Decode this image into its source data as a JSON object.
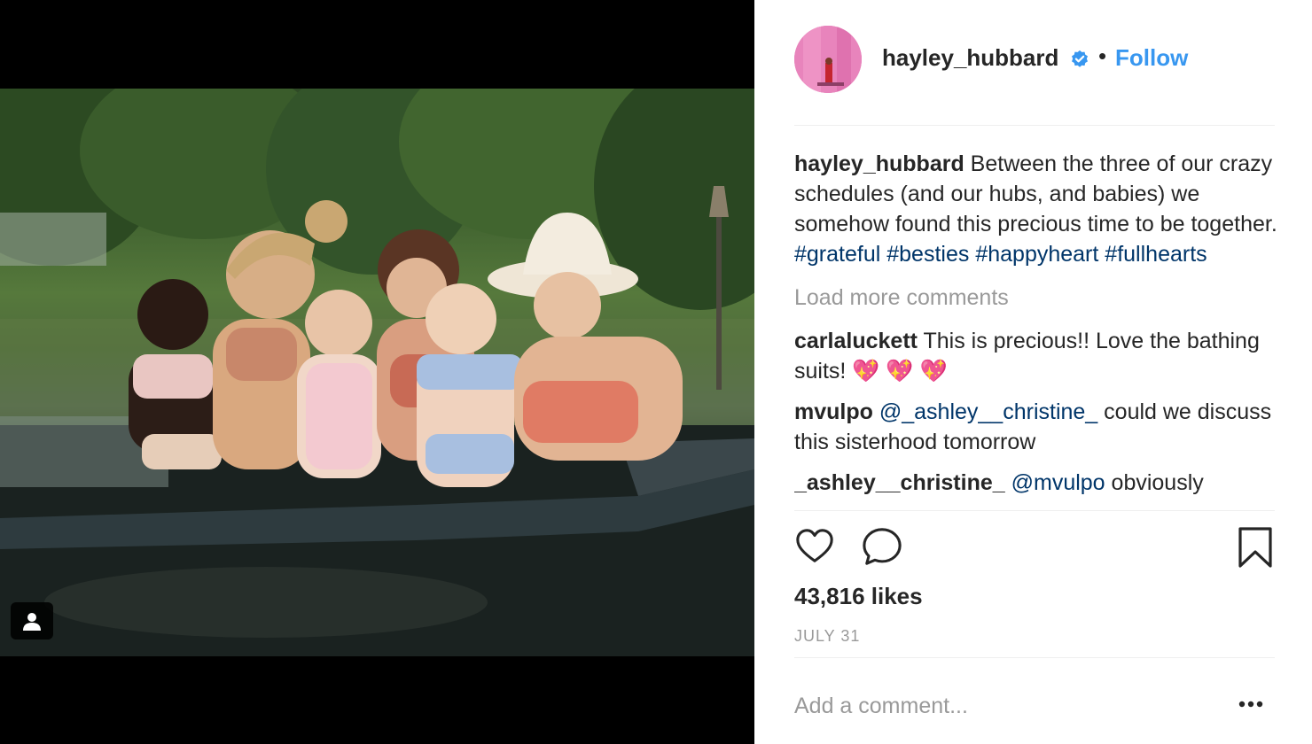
{
  "post": {
    "username": "hayley_hubbard",
    "separator": "•",
    "follow_label": "Follow",
    "verified_icon": "verified-badge-icon",
    "caption_username": "hayley_hubbard",
    "caption_text": " Between the three of our crazy schedules (and our hubs, and babies) we somehow found this precious time to be together. ",
    "hashtags": [
      "#grateful",
      "#besties",
      "#happyheart",
      "#fullhearts"
    ],
    "load_more_label": "Load more comments",
    "comments": [
      {
        "username": "carlaluckett",
        "text": " This is precious!! Love the bathing suits! 💖 💖 💖"
      },
      {
        "username": "mvulpo",
        "mention": "@_ashley__christine_",
        "text": " could we discuss this sisterhood tomorrow"
      },
      {
        "username": "_ashley__christine_",
        "mention": "@mvulpo",
        "text": " obviously"
      }
    ],
    "likes_label": "43,816 likes",
    "date_label": "JULY 31",
    "add_comment_placeholder": "Add a comment...",
    "more_label": "•••"
  },
  "colors": {
    "link_blue": "#3897f0",
    "hashtag_navy": "#003569",
    "muted_gray": "#999999",
    "text": "#262626",
    "divider": "#efefef",
    "avatar_pink": "#e779b6"
  },
  "icons": {
    "like": "heart-icon",
    "comment": "comment-bubble-icon",
    "save": "bookmark-icon",
    "tagged_people": "user-tag-icon",
    "more": "ellipsis-icon"
  }
}
